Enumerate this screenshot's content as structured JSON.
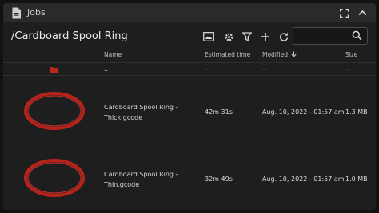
{
  "window": {
    "title": "Jobs",
    "icon": "file-document-icon"
  },
  "toolbar": {
    "path": "/Cardboard Spool Ring",
    "tools": [
      "image-view-icon",
      "settings-gear-icon",
      "filter-icon",
      "add-icon",
      "refresh-icon"
    ],
    "search": {
      "value": "",
      "placeholder": ""
    }
  },
  "table": {
    "headers": {
      "name": "Name",
      "time": "Estimated time",
      "modified": "Modified",
      "size": "Size"
    },
    "parent_row": {
      "name": "..",
      "time": "--",
      "modified": "--",
      "size": "--"
    },
    "rows": [
      {
        "name_line1": "Cardboard Spool Ring -",
        "name_line2": "Thick.gcode",
        "time": "42m 31s",
        "modified": "Aug. 10, 2022 - 01:57 am",
        "size": "1.3 MB"
      },
      {
        "name_line1": "Cardboard Spool Ring -",
        "name_line2": "Thin.gcode",
        "time": "32m 49s",
        "modified": "Aug. 10, 2022 - 01:57 am",
        "size": "1.0 MB"
      }
    ]
  },
  "colors": {
    "accent": "#c0261e",
    "background": "#1e1e1e",
    "titlebar": "#2a2a2a"
  }
}
